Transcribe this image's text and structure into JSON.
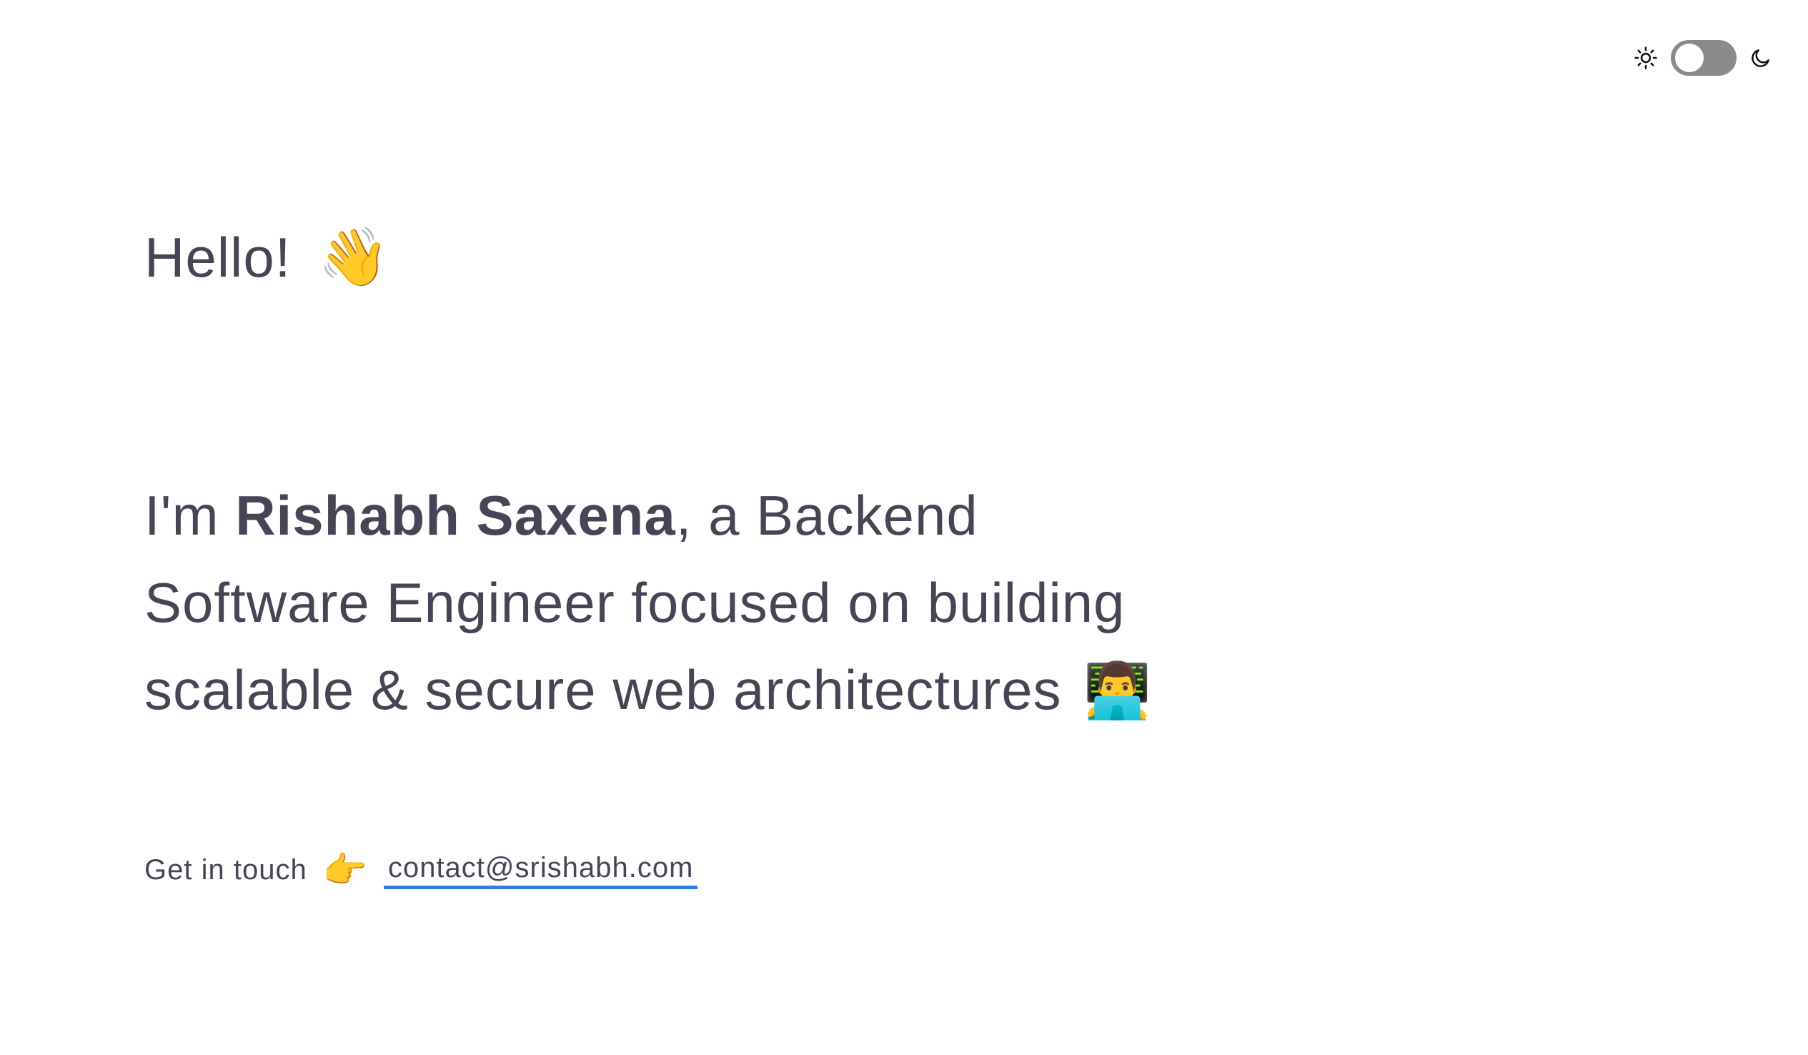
{
  "theme_toggle": {
    "light_icon": "sun-icon",
    "dark_icon": "moon-icon",
    "state": "light"
  },
  "hero": {
    "greeting": "Hello!",
    "greeting_emoji": "👋",
    "intro_prefix": "I'm ",
    "name": "Rishabh Saxena",
    "intro_suffix": ", a Backend Software Engineer focused on building scalable & secure web architectures",
    "intro_emoji": "👨‍💻"
  },
  "contact": {
    "label": "Get in touch",
    "pointer_emoji": "👉",
    "email": "contact@srishabh.com",
    "underline_color": "#2f7be8"
  },
  "colors": {
    "text": "#484455",
    "toggle_track": "#8a8a8a"
  }
}
